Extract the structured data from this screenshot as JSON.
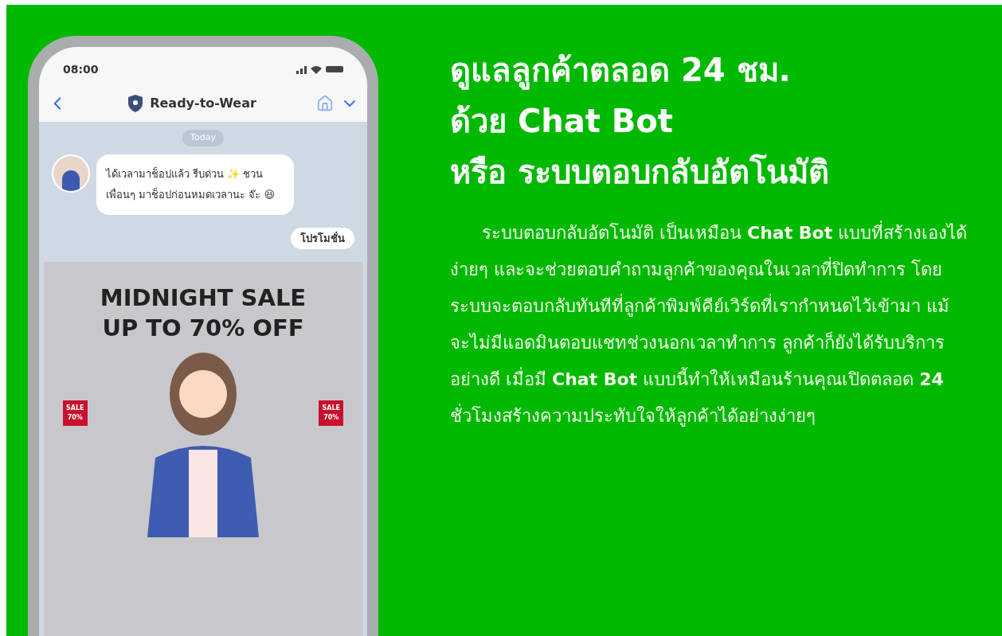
{
  "phone": {
    "status_bar": {
      "time": "08:00"
    },
    "chat_header": {
      "title": "Ready-to-Wear"
    },
    "date_chip": "Today",
    "messages": [
      {
        "kind": "incoming",
        "text": "ได้เวลามาช็อปแล้ว รีบด่วน ✨ ชวนเพื่อนๆ มาช็อปก่อนหมดเวลานะ จ๊ะ 😆"
      },
      {
        "kind": "outgoing",
        "text": "โปรโมชั่น"
      }
    ],
    "promo_image": {
      "headline_lines": [
        "MIDNIGHT SALE",
        "UP TO 70% OFF"
      ],
      "tags": [
        {
          "line_1": "SALE",
          "line_2": "70%"
        },
        {
          "line_1": "SALE",
          "line_2": "70%"
        }
      ]
    }
  },
  "headline_lines": [
    "ดูแลลูกค้าตลอด 24 ชม.",
    "ด้วย Chat Bot",
    "หรือ ระบบตอบกลับอัตโนมัติ"
  ],
  "body": "ระบบตอบกลับอัตโนมัติ เป็นเหมือน **Chat Bot** แบบที่สร้างเองได้ง่ายๆ และจะช่วยตอบคำถามลูกค้าของคุณในเวลาที่ปิดทำการ โดยระบบจะตอบกลับทันทีที่ลูกค้าพิมพ์คีย์เวิร์ดที่เรากำหนดไว้เข้ามา แม้จะไม่มีแอดมินตอบแชทช่วงนอกเวลาทำการ ลูกค้าก็ยังได้รับบริการอย่างดี เมื่อมี **Chat Bot** แบบนี้ทำให้เหมือนร้านคุณเปิดตลอด **24** ชั่วโมงสร้างความประทับใจให้ลูกค้าได้อย่างง่ายๆ"
}
